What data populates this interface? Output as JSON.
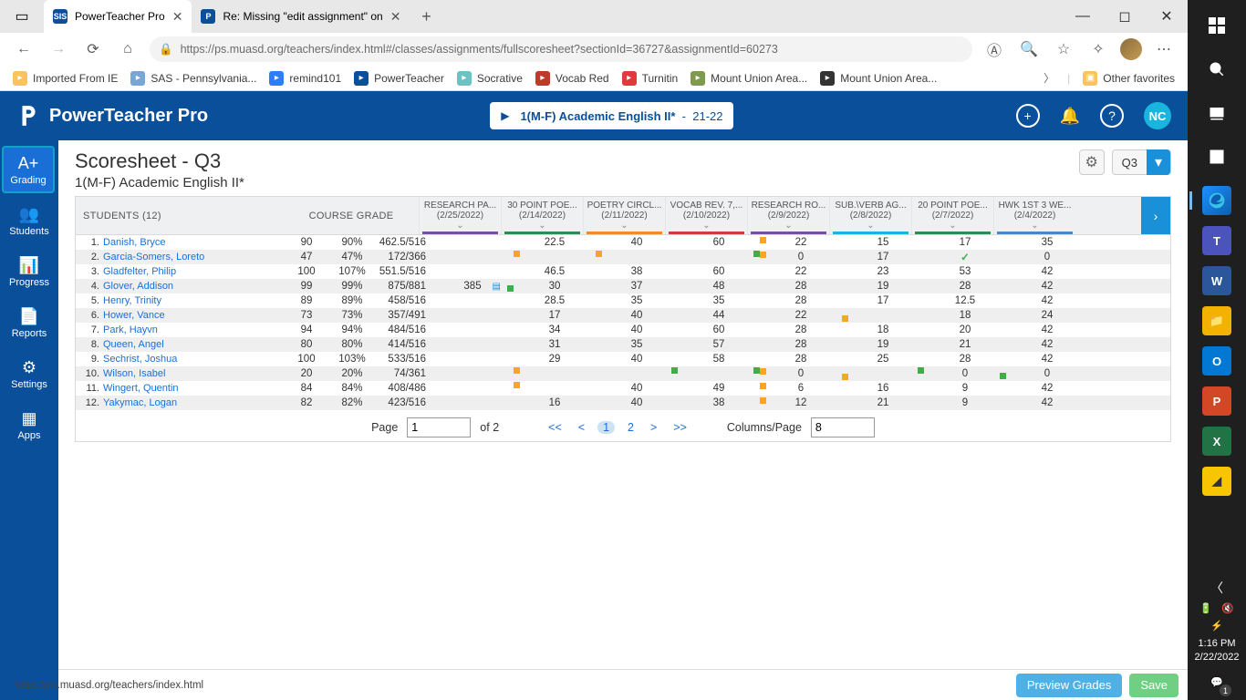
{
  "browser": {
    "tabs": [
      {
        "title": "PowerTeacher Pro",
        "favicon_bg": "#0a4f9a",
        "favicon_text": "SIS",
        "active": true
      },
      {
        "title": "Re: Missing \"edit assignment\" on",
        "favicon_bg": "#0a4f9a",
        "favicon_text": "P",
        "active": false
      }
    ],
    "url": "https://ps.muasd.org/teachers/index.html#/classes/assignments/fullscoresheet?sectionId=36727&assignmentId=60273",
    "bookmarks": [
      {
        "label": "Imported From IE",
        "color": "#f7c45e"
      },
      {
        "label": "SAS - Pennsylvania...",
        "color": "#7aa6d6"
      },
      {
        "label": "remind101",
        "color": "#2d7ff9"
      },
      {
        "label": "PowerTeacher",
        "color": "#0a4f9a"
      },
      {
        "label": "Socrative",
        "color": "#6bc2c2"
      },
      {
        "label": "Vocab Red",
        "color": "#c0392b"
      },
      {
        "label": "Turnitin",
        "color": "#e03a3e"
      },
      {
        "label": "Mount Union Area...",
        "color": "#7d9a4e"
      },
      {
        "label": "Mount Union Area...",
        "color": "#333333"
      }
    ],
    "other_favorites": "Other favorites"
  },
  "win": {
    "time": "1:16 PM",
    "date": "2/22/2022",
    "notif_count": "1"
  },
  "app": {
    "brand": "PowerTeacher Pro",
    "class_picker": {
      "label": "1(M-F) Academic English II*",
      "year": "21-22"
    },
    "user_initials": "NC"
  },
  "rail": [
    {
      "label": "Grading",
      "active": true,
      "icon": "A+"
    },
    {
      "label": "Students",
      "active": false,
      "icon": "👥"
    },
    {
      "label": "Progress",
      "active": false,
      "icon": "📊"
    },
    {
      "label": "Reports",
      "active": false,
      "icon": "📄"
    },
    {
      "label": "Settings",
      "active": false,
      "icon": "⚙"
    },
    {
      "label": "Apps",
      "active": false,
      "icon": "▦"
    }
  ],
  "page": {
    "title": "Scoresheet - Q3",
    "subtitle": "1(M-F) Academic English II*",
    "term": "Q3",
    "students_header": "STUDENTS (12)",
    "course_grade_header": "COURSE GRADE"
  },
  "assignments": [
    {
      "name": "RESEARCH PA...",
      "date": "(2/25/2022)",
      "color": "#7b4fa0"
    },
    {
      "name": "30 POINT POE...",
      "date": "(2/14/2022)",
      "color": "#2e8b57"
    },
    {
      "name": "POETRY CIRCL...",
      "date": "(2/11/2022)",
      "color": "#f08b2c"
    },
    {
      "name": "VOCAB REV. 7,...",
      "date": "(2/10/2022)",
      "color": "#d23b3b"
    },
    {
      "name": "RESEARCH RO...",
      "date": "(2/9/2022)",
      "color": "#7b4fa0"
    },
    {
      "name": "SUB.\\VERB AG...",
      "date": "(2/8/2022)",
      "color": "#19b5de"
    },
    {
      "name": "20 POINT POE...",
      "date": "(2/7/2022)",
      "color": "#2e8b57"
    },
    {
      "name": "HWK 1ST 3 WE...",
      "date": "(2/4/2022)",
      "color": "#4b86c6"
    }
  ],
  "rows": [
    {
      "n": "1.",
      "name": "Danish, Bryce",
      "gr": "90",
      "pct": "90%",
      "pts": "462.5/516",
      "s": [
        "",
        "22.5",
        "40",
        "60",
        "22",
        "15",
        "17",
        "35"
      ],
      "f": [
        [],
        [],
        [],
        [],
        [
          [
            "tl",
            "o"
          ]
        ],
        [],
        [],
        []
      ]
    },
    {
      "n": "2.",
      "name": "Garcia-Somers, Loreto",
      "gr": "47",
      "pct": "47%",
      "pts": "172/366",
      "s": [
        "",
        "",
        "",
        "",
        "0",
        "17",
        "check",
        "0"
      ],
      "f": [
        [],
        [
          [
            "bl",
            "o"
          ]
        ],
        [
          [
            "bl",
            "o"
          ]
        ],
        [
          [
            "br",
            "g"
          ]
        ],
        [
          [
            "tl",
            "o"
          ]
        ],
        [],
        [],
        []
      ]
    },
    {
      "n": "3.",
      "name": "Gladfelter, Philip",
      "gr": "100",
      "pct": "107%",
      "pts": "551.5/516",
      "s": [
        "",
        "46.5",
        "38",
        "60",
        "22",
        "23",
        "53",
        "42"
      ],
      "f": [
        [],
        [],
        [],
        [],
        [],
        [],
        [],
        []
      ]
    },
    {
      "n": "4.",
      "name": "Glover, Addison",
      "gr": "99",
      "pct": "99%",
      "pts": "875/881",
      "s": [
        "385",
        "30",
        "37",
        "48",
        "28",
        "19",
        "28",
        "42"
      ],
      "f": [
        [
          [
            "cmt",
            ""
          ],
          [
            "br",
            "g"
          ]
        ],
        [],
        [],
        [],
        [],
        [],
        [],
        []
      ]
    },
    {
      "n": "5.",
      "name": "Henry, Trinity",
      "gr": "89",
      "pct": "89%",
      "pts": "458/516",
      "s": [
        "",
        "28.5",
        "35",
        "35",
        "28",
        "17",
        "12.5",
        "42"
      ],
      "f": [
        [],
        [],
        [],
        [],
        [],
        [],
        [],
        []
      ]
    },
    {
      "n": "6.",
      "name": "Hower, Vance",
      "gr": "73",
      "pct": "73%",
      "pts": "357/491",
      "s": [
        "",
        "17",
        "40",
        "44",
        "22",
        "",
        "18",
        "24"
      ],
      "f": [
        [],
        [],
        [],
        [],
        [],
        [
          [
            "tl",
            "o"
          ]
        ],
        [],
        []
      ]
    },
    {
      "n": "7.",
      "name": "Park, Hayvn",
      "gr": "94",
      "pct": "94%",
      "pts": "484/516",
      "s": [
        "",
        "34",
        "40",
        "60",
        "28",
        "18",
        "20",
        "42"
      ],
      "f": [
        [],
        [],
        [],
        [],
        [],
        [],
        [],
        []
      ]
    },
    {
      "n": "8.",
      "name": "Queen, Angel",
      "gr": "80",
      "pct": "80%",
      "pts": "414/516",
      "s": [
        "",
        "31",
        "35",
        "57",
        "28",
        "19",
        "21",
        "42"
      ],
      "f": [
        [],
        [],
        [],
        [],
        [],
        [],
        [],
        []
      ]
    },
    {
      "n": "9.",
      "name": "Sechrist, Joshua",
      "gr": "100",
      "pct": "103%",
      "pts": "533/516",
      "s": [
        "",
        "29",
        "40",
        "58",
        "28",
        "25",
        "28",
        "42"
      ],
      "f": [
        [],
        [],
        [],
        [],
        [],
        [],
        [],
        []
      ]
    },
    {
      "n": "10.",
      "name": "Wilson, Isabel",
      "gr": "20",
      "pct": "20%",
      "pts": "74/361",
      "s": [
        "",
        "",
        "",
        "",
        "0",
        "",
        "0",
        "0"
      ],
      "f": [
        [],
        [
          [
            "bl",
            "o"
          ]
        ],
        [
          [
            "br",
            "g"
          ]
        ],
        [
          [
            "br",
            "g"
          ]
        ],
        [
          [
            "tl",
            "o"
          ]
        ],
        [
          [
            "tl",
            "o"
          ],
          [
            "br",
            "g"
          ]
        ],
        [
          [
            "br",
            "g"
          ]
        ],
        []
      ]
    },
    {
      "n": "11.",
      "name": "Wingert, Quentin",
      "gr": "84",
      "pct": "84%",
      "pts": "408/486",
      "s": [
        "",
        "",
        "40",
        "49",
        "6",
        "16",
        "9",
        "42"
      ],
      "f": [
        [],
        [
          [
            "bl",
            "o"
          ]
        ],
        [],
        [],
        [
          [
            "tl",
            "o"
          ]
        ],
        [],
        [],
        []
      ]
    },
    {
      "n": "12.",
      "name": "Yakymac, Logan",
      "gr": "82",
      "pct": "82%",
      "pts": "423/516",
      "s": [
        "",
        "16",
        "40",
        "38",
        "12",
        "21",
        "9",
        "42"
      ],
      "f": [
        [],
        [],
        [],
        [],
        [
          [
            "tl",
            "o"
          ]
        ],
        [],
        [],
        []
      ]
    }
  ],
  "pager": {
    "page_label": "Page",
    "page_value": "1",
    "of_label": "of 2",
    "cols_label": "Columns/Page",
    "cols_value": "8"
  },
  "footer": {
    "status": "https://ps.muasd.org/teachers/index.html",
    "preview": "Preview Grades",
    "save": "Save"
  }
}
